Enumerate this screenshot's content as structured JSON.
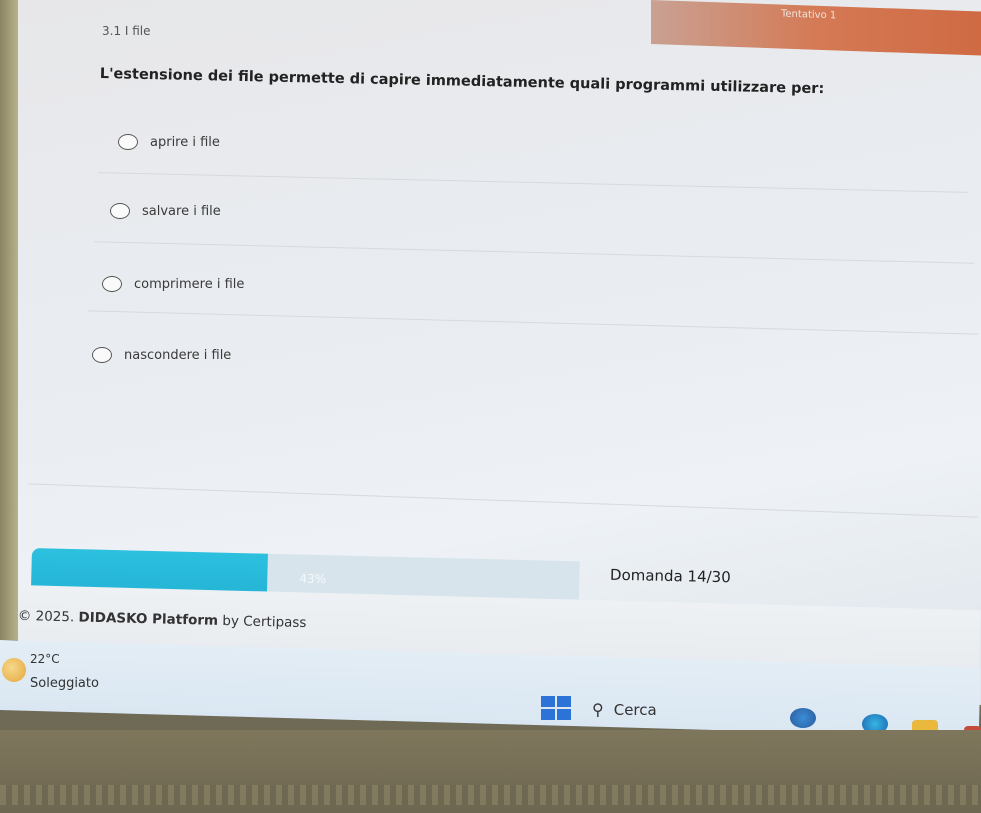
{
  "header": {
    "attempt_label": "Tentativo 1",
    "breadcrumb": "3.1 I file"
  },
  "question": {
    "text": "L'estensione dei file permette di capire immediatamente quali programmi utilizzare per:",
    "options": [
      {
        "label": "aprire i file"
      },
      {
        "label": "salvare i file"
      },
      {
        "label": "comprimere i file"
      },
      {
        "label": "nascondere i file"
      }
    ]
  },
  "progress": {
    "percent": 43,
    "label": "43%",
    "question_counter": "Domanda 14/30"
  },
  "footer": {
    "copyright_prefix": "© 2025. ",
    "platform": "DIDASKO Platform",
    "suffix": " by Certipass"
  },
  "taskbar": {
    "temperature": "22°C",
    "condition": "Soleggiato",
    "search_label": "Cerca"
  },
  "colors": {
    "progress_fill": "#23b1d3",
    "progress_track": "#d7e4ec",
    "top_strip": "#cf6a43",
    "start_button": "#2b73d6"
  },
  "icons": [
    "weather-sun-icon",
    "start-icon",
    "search-icon",
    "app-icon",
    "edge-browser-icon",
    "file-explorer-icon",
    "app-icon-red"
  ]
}
